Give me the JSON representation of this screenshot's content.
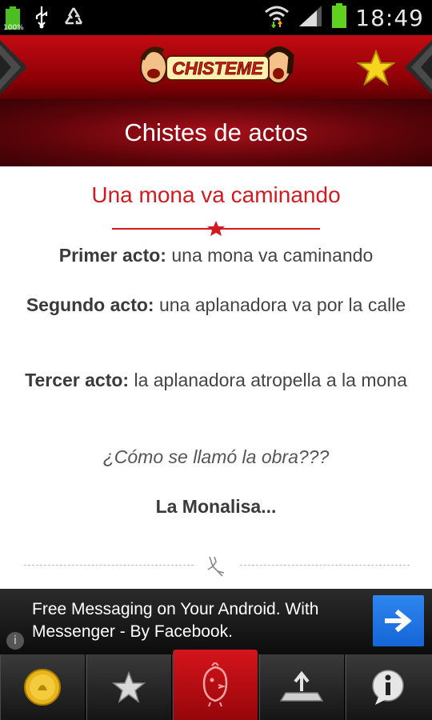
{
  "status_bar": {
    "battery_small_label": "100%",
    "time": "18:49",
    "icons": [
      "battery-icon",
      "usb-icon",
      "recycle-icon",
      "wifi-icon",
      "signal-icon",
      "battery-icon"
    ]
  },
  "header": {
    "logo_text": "CHISTEME",
    "icons": [
      "nav-left-icon",
      "favorite-star-icon",
      "nav-right-icon"
    ]
  },
  "category_title": "Chistes de actos",
  "joke": {
    "title": "Una mona va caminando",
    "acts": [
      {
        "label": "Primer acto:",
        "text": "una mona va caminando"
      },
      {
        "label": "Segundo acto:",
        "text": "una aplanadora va por la calle"
      },
      {
        "label": "Tercer acto:",
        "text": "la aplanadora atropella a la mona"
      }
    ],
    "question": "¿Cómo se llamó la obra???",
    "answer": "La Monalisa..."
  },
  "ad": {
    "text": "Free Messaging on Your Android. With Messenger - By Facebook.",
    "info_label": "i",
    "button_icon": "arrow-right-icon"
  },
  "tabs": [
    {
      "name": "coin",
      "icon": "coin-icon",
      "active": false
    },
    {
      "name": "favorites",
      "icon": "star-icon",
      "active": false
    },
    {
      "name": "home",
      "icon": "chicken-icon",
      "active": true
    },
    {
      "name": "share",
      "icon": "upload-icon",
      "active": false
    },
    {
      "name": "info",
      "icon": "info-icon",
      "active": false
    }
  ],
  "colors": {
    "brand_red": "#c40b12",
    "title_red": "#d21b20",
    "ad_blue": "#1e74e0",
    "star_yellow": "#f5d51e"
  }
}
